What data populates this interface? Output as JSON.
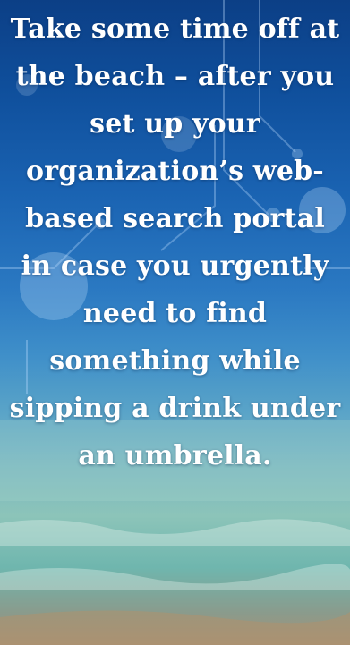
{
  "poster": {
    "message": "Take some time off at the beach – after you set up your organization’s web-based search portal in case you urgently need to find something while sipping a drink under an umbrella."
  },
  "colors": {
    "sky_top": "#0c3f86",
    "sky_mid": "#2b79c2",
    "sea": "#6fb6ae",
    "sand": "#a79176",
    "text": "#ffffff"
  }
}
